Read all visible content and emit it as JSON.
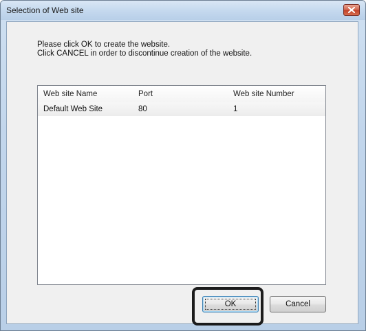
{
  "window": {
    "title": "Selection of Web site"
  },
  "message": {
    "line1": "Please click OK to create the website.",
    "line2": "Click CANCEL in order to discontinue creation of the website."
  },
  "table": {
    "headers": [
      "Web site Name",
      "Port",
      "Web site Number"
    ],
    "rows": [
      [
        "Default Web Site",
        "80",
        "1"
      ]
    ]
  },
  "buttons": {
    "ok": "OK",
    "cancel": "Cancel"
  },
  "colors": {
    "close_button": "#d46a52",
    "ok_border": "#3c7fb1",
    "annotation_box": "#1c1c1c"
  },
  "icons": {
    "close": "close-icon"
  }
}
